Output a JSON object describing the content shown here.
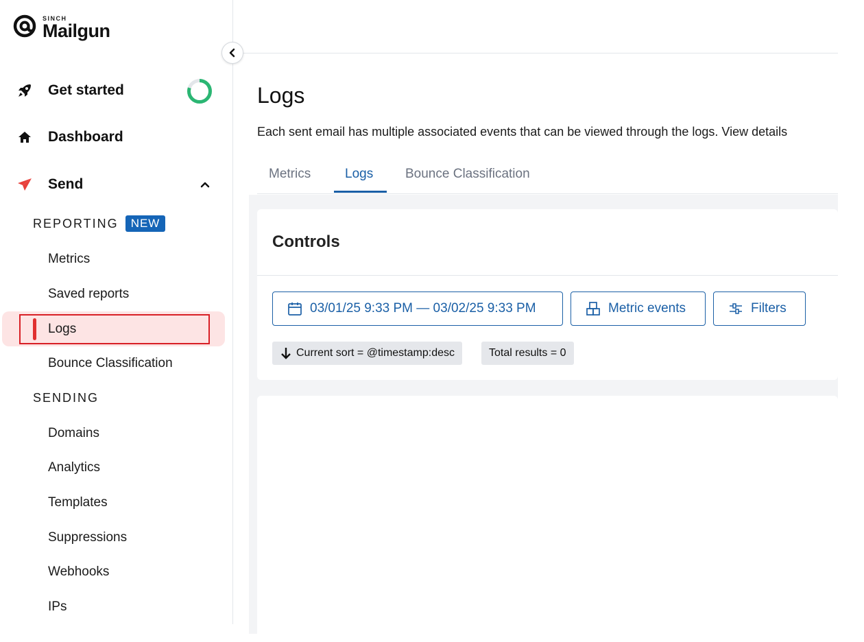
{
  "brand": {
    "sinch": "SINCH",
    "name": "Mailgun"
  },
  "sidebar": {
    "main_items": [
      {
        "label": "Get started",
        "icon": "rocket-icon"
      },
      {
        "label": "Dashboard",
        "icon": "home-icon"
      },
      {
        "label": "Send",
        "icon": "paper-plane-icon",
        "expanded": true
      }
    ],
    "get_started_progress": 0.8,
    "sections": [
      {
        "heading": "REPORTING",
        "badge": "NEW",
        "items": [
          "Metrics",
          "Saved reports",
          "Logs",
          "Bounce Classification"
        ]
      },
      {
        "heading": "SENDING",
        "items": [
          "Domains",
          "Analytics",
          "Templates",
          "Suppressions",
          "Webhooks",
          "IPs"
        ]
      }
    ],
    "active_item": "Logs"
  },
  "page": {
    "title": "Logs",
    "description": "Each sent email has multiple associated events that can be viewed through the logs. View details"
  },
  "tabs": [
    {
      "label": "Metrics",
      "active": false
    },
    {
      "label": "Logs",
      "active": true
    },
    {
      "label": "Bounce Classification",
      "active": false
    }
  ],
  "controls": {
    "title": "Controls",
    "date_range": "03/01/25 9:33 PM — 03/02/25 9:33 PM",
    "metric_events_label": "Metric events",
    "filters_label": "Filters",
    "sort_chip": "Current sort = @timestamp:desc",
    "total_chip": "Total results = 0"
  },
  "colors": {
    "accent": "#1a5fa6",
    "active_bg": "#fde4e4",
    "active_border": "#d81f26",
    "badge": "#1565b7",
    "progress": "#2bb673"
  }
}
